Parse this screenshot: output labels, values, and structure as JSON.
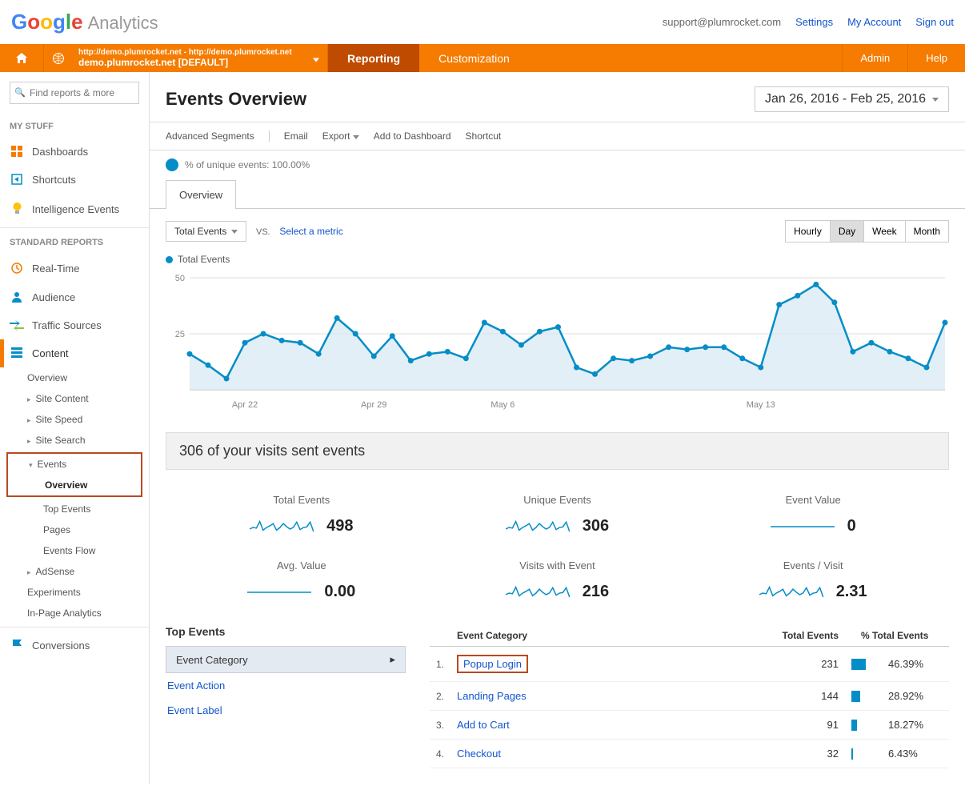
{
  "header": {
    "logo_google": "Google",
    "logo_analytics": "Analytics",
    "email": "support@plumrocket.com",
    "settings": "Settings",
    "my_account": "My Account",
    "sign_out": "Sign out"
  },
  "nav": {
    "property_line1": "http://demo.plumrocket.net - http://demo.plumrocket.net",
    "property_line2": "demo.plumrocket.net [DEFAULT]",
    "reporting": "Reporting",
    "customization": "Customization",
    "admin": "Admin",
    "help": "Help"
  },
  "sidebar": {
    "search_placeholder": "Find reports & more",
    "my_stuff_heading": "MY STUFF",
    "my_stuff": {
      "dashboards": "Dashboards",
      "shortcuts": "Shortcuts",
      "intelligence": "Intelligence Events"
    },
    "standard_heading": "STANDARD REPORTS",
    "standard": {
      "realtime": "Real-Time",
      "audience": "Audience",
      "traffic": "Traffic Sources",
      "content": "Content",
      "conversions": "Conversions"
    },
    "content_sub": {
      "overview": "Overview",
      "site_content": "Site Content",
      "site_speed": "Site Speed",
      "site_search": "Site Search",
      "events": "Events",
      "adsense": "AdSense",
      "experiments": "Experiments",
      "inpage": "In-Page Analytics"
    },
    "events_sub": {
      "overview": "Overview",
      "top_events": "Top Events",
      "pages": "Pages",
      "events_flow": "Events Flow"
    }
  },
  "page": {
    "title": "Events Overview",
    "date_range": "Jan 26, 2016 - Feb 25, 2016"
  },
  "toolbar": {
    "adv_seg": "Advanced Segments",
    "email": "Email",
    "export": "Export",
    "add_dash": "Add to Dashboard",
    "shortcut": "Shortcut"
  },
  "segments_text": "% of unique events: 100.00%",
  "tabs": {
    "overview": "Overview"
  },
  "chart": {
    "metric": "Total Events",
    "vs": "VS.",
    "select_metric": "Select a metric",
    "granularity": [
      "Hourly",
      "Day",
      "Week",
      "Month"
    ],
    "granularity_active": "Day",
    "legend": "Total Events"
  },
  "chart_data": {
    "type": "line",
    "title": "Total Events",
    "ylabel": "",
    "ylim": [
      0,
      50
    ],
    "y_ticks": [
      25,
      50
    ],
    "x_ticks": [
      "Apr 22",
      "Apr 29",
      "May 6",
      "May 13"
    ],
    "values": [
      16,
      11,
      5,
      21,
      25,
      22,
      21,
      16,
      32,
      25,
      15,
      24,
      13,
      16,
      17,
      14,
      30,
      26,
      20,
      26,
      28,
      10,
      7,
      14,
      13,
      15,
      19,
      18,
      19,
      19,
      14,
      10,
      38,
      42,
      47,
      39,
      17,
      21,
      17,
      14,
      10,
      30
    ]
  },
  "summary": "306 of your visits sent events",
  "metrics": [
    {
      "label": "Total Events",
      "value": "498",
      "spark_type": "noise"
    },
    {
      "label": "Unique Events",
      "value": "306",
      "spark_type": "noise"
    },
    {
      "label": "Event Value",
      "value": "0",
      "spark_type": "flat"
    },
    {
      "label": "Avg. Value",
      "value": "0.00",
      "spark_type": "flat"
    },
    {
      "label": "Visits with Event",
      "value": "216",
      "spark_type": "noise"
    },
    {
      "label": "Events / Visit",
      "value": "2.31",
      "spark_type": "noise"
    }
  ],
  "top_events": {
    "heading": "Top Events",
    "primary_dim": "Event Category",
    "dims": [
      "Event Action",
      "Event Label"
    ]
  },
  "ev_table": {
    "col_category": "Event Category",
    "col_total": "Total Events",
    "col_pct": "% Total Events",
    "rows": [
      {
        "idx": "1",
        "name": "Popup Login",
        "total": "231",
        "pct": "46.39%",
        "pct_val": 46.39,
        "highlight": true
      },
      {
        "idx": "2",
        "name": "Landing Pages",
        "total": "144",
        "pct": "28.92%",
        "pct_val": 28.92
      },
      {
        "idx": "3",
        "name": "Add to Cart",
        "total": "91",
        "pct": "18.27%",
        "pct_val": 18.27
      },
      {
        "idx": "4",
        "name": "Checkout",
        "total": "32",
        "pct": "6.43%",
        "pct_val": 6.43
      }
    ]
  }
}
